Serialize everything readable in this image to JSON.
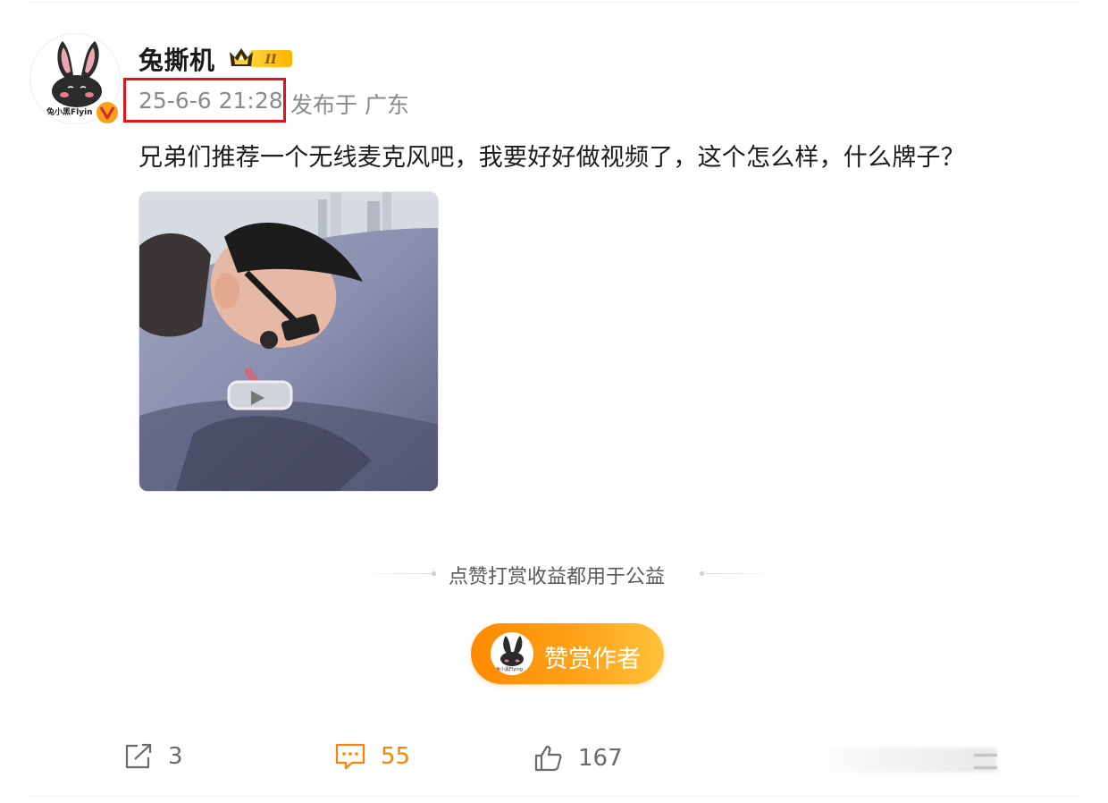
{
  "post": {
    "author": {
      "name": "兔撕机",
      "avatar_text": "兔小黑Flyin",
      "verified_badge": "V",
      "level_badge": "II"
    },
    "timestamp": "25-6-6 21:28",
    "publish_location": "发布于 广东",
    "text": "兄弟们推荐一个无线麦克风吧，我要好好做视频了，这个怎么样，什么牌子？"
  },
  "donation": {
    "note": "点赞打赏收益都用于公益",
    "button_label": "赞赏作者",
    "button_avatar_text": "兔小黑Flying"
  },
  "actions": {
    "share_count": "3",
    "comment_count": "55",
    "like_count": "167"
  },
  "colors": {
    "highlight_box": "#e3151a",
    "comment_accent": "#ff8200",
    "reward_gradient_start": "#ff8a00",
    "reward_gradient_end": "#ffc23a",
    "verified_badge": "#f7a21b"
  },
  "icons": {
    "share": "share-icon",
    "comment": "comment-icon",
    "like": "thumbs-up-icon"
  }
}
